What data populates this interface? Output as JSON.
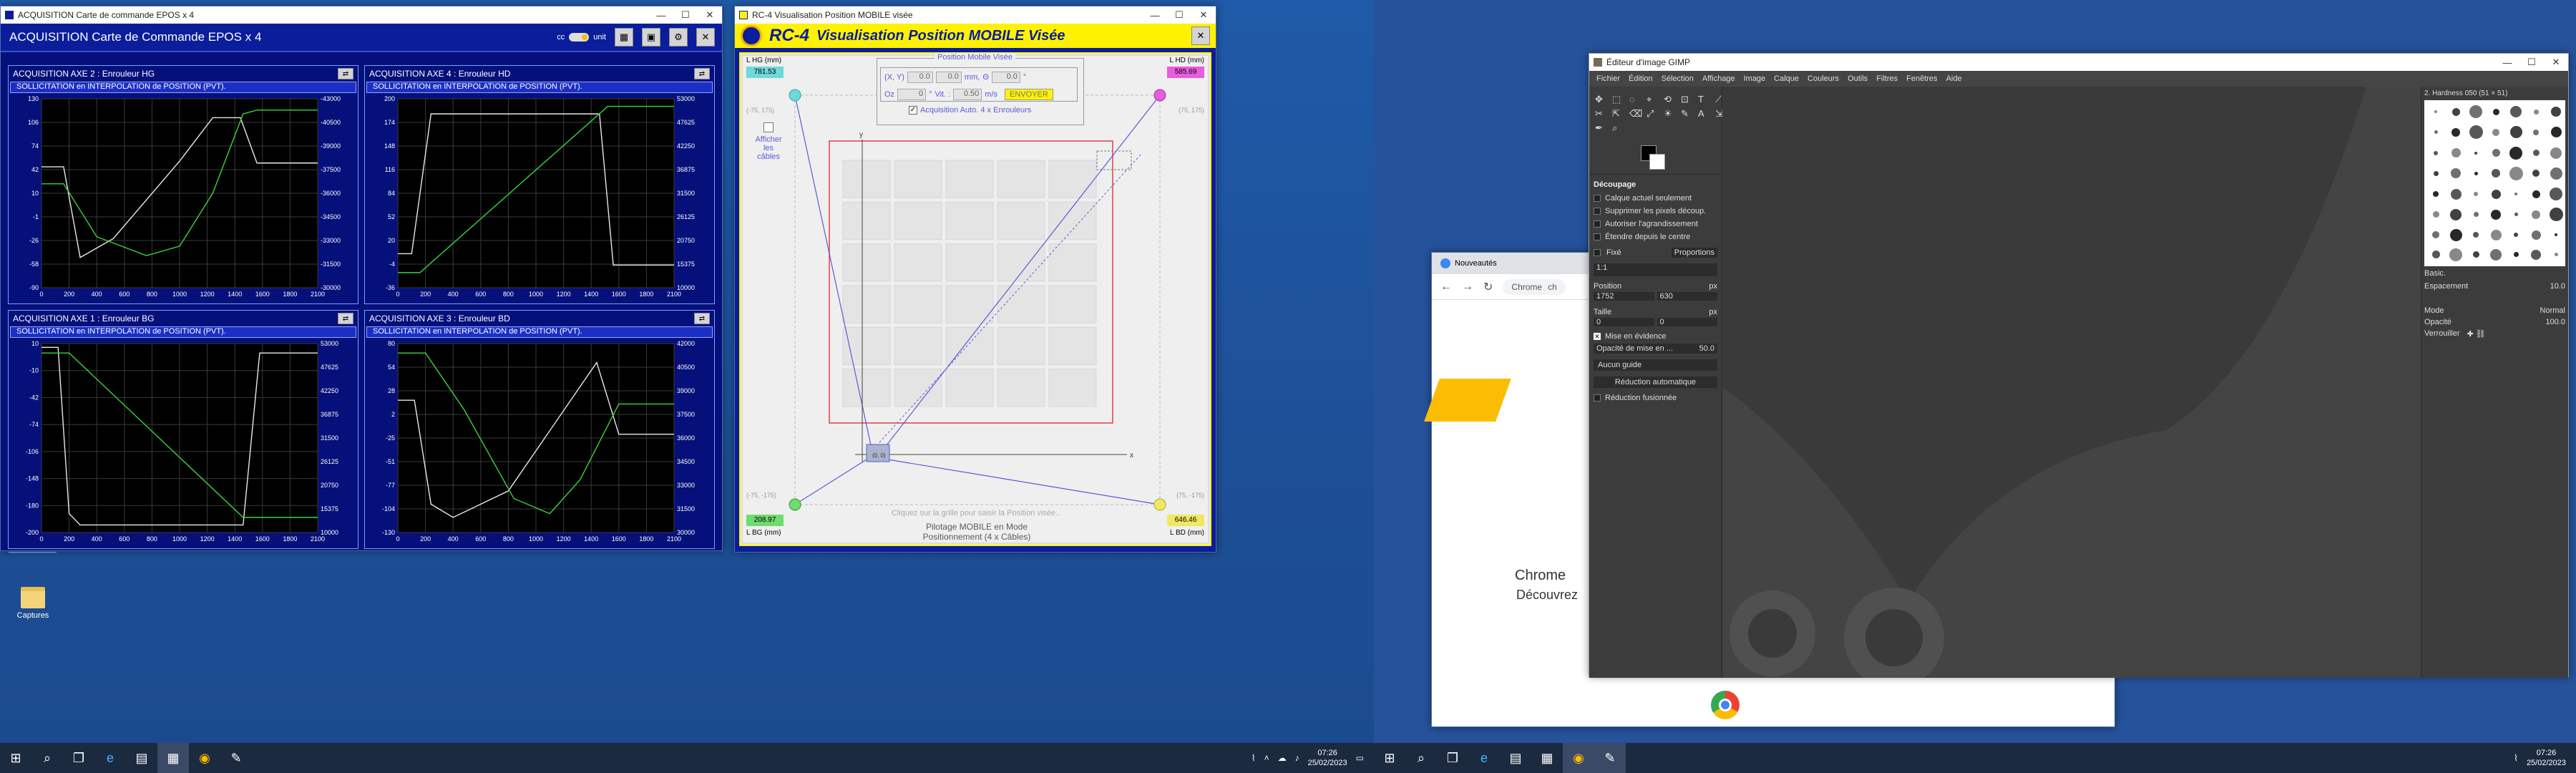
{
  "desktop": {
    "icon_label": "Captures",
    "icon_label_top": "____________"
  },
  "epos": {
    "window_title": "ACQUISITION Carte de commande EPOS x 4",
    "header": "ACQUISITION Carte de Commande EPOS x 4",
    "header_units": "unit",
    "header_pct": "cc",
    "panels": [
      {
        "title": "ACQUISITION AXE 2 : Enrouleur HG",
        "sub": "SOLLICITATION en INTERPOLATION de POSITION (PVT).",
        "left_ticks": [
          "130",
          "106",
          "74",
          "42",
          "10",
          "-1",
          "-26",
          "-58",
          "-90"
        ],
        "right_ticks": [
          "-43000",
          "-40500",
          "-39000",
          "-37500",
          "-36000",
          "-34500",
          "-33000",
          "-31500",
          "-30000"
        ],
        "x_ticks": [
          "0",
          "200",
          "400",
          "600",
          "800",
          "1000",
          "1200",
          "1400",
          "1600",
          "1800",
          "2100"
        ]
      },
      {
        "title": "ACQUISITION AXE 4 : Enrouleur HD",
        "sub": "SOLLICITATION en INTERPOLATION de POSITION (PVT).",
        "left_ticks": [
          "200",
          "174",
          "148",
          "116",
          "84",
          "52",
          "20",
          "-4",
          "-36"
        ],
        "right_ticks": [
          "53000",
          "47625",
          "42250",
          "36875",
          "31500",
          "26125",
          "20750",
          "15375",
          "10000"
        ],
        "x_ticks": [
          "0",
          "200",
          "400",
          "600",
          "800",
          "1000",
          "1200",
          "1400",
          "1600",
          "1800",
          "2100"
        ]
      },
      {
        "title": "ACQUISITION AXE 1 : Enrouleur BG",
        "sub": "SOLLICITATION en INTERPOLATION de POSITION (PVT).",
        "left_ticks": [
          "10",
          "-10",
          "-42",
          "-74",
          "-106",
          "-148",
          "-180",
          "-200"
        ],
        "right_ticks": [
          "53000",
          "47625",
          "42250",
          "36875",
          "31500",
          "26125",
          "20750",
          "15375",
          "10000"
        ],
        "x_ticks": [
          "0",
          "200",
          "400",
          "600",
          "800",
          "1000",
          "1200",
          "1400",
          "1600",
          "1800",
          "2100"
        ]
      },
      {
        "title": "ACQUISITION AXE 3 : Enrouleur BD",
        "sub": "SOLLICITATION en INTERPOLATION de POSITION (PVT).",
        "left_ticks": [
          "80",
          "54",
          "28",
          "2",
          "-25",
          "-51",
          "-77",
          "-104",
          "-130"
        ],
        "right_ticks": [
          "42000",
          "40500",
          "39000",
          "37500",
          "36000",
          "34500",
          "33000",
          "31500",
          "30000"
        ],
        "x_ticks": [
          "0",
          "200",
          "400",
          "600",
          "800",
          "1000",
          "1200",
          "1400",
          "1600",
          "1800",
          "2100"
        ]
      }
    ]
  },
  "rc4": {
    "window_title": "RC-4 Visualisation Position MOBILE visée",
    "logo": "RC-4",
    "title": "Visualisation Position MOBILE Visée",
    "lhg": "L HG (mm)",
    "lhd": "L HD (mm)",
    "lbg": "L BG (mm)",
    "lbd": "L BD (mm)",
    "val_hg": "781.53",
    "val_hd": "585.69",
    "val_bg": "208.97",
    "val_bd": "646.46",
    "coord_hg": "(-75, 175)",
    "coord_hd": "(75, 175)",
    "coord_bg": "(-75, -175)",
    "coord_bd": "(75, -175)",
    "afficher": "Afficher",
    "les": "les",
    "cables": "câbles",
    "group_title": "Position Mobile Visée",
    "xy_label": "(X, Y)",
    "x_val": "0.0",
    "y_val": "0.0",
    "mm": "mm,",
    "theta_label": "Θ",
    "theta_val": "0.0",
    "deg": "°",
    "oz_label": "Oz",
    "oz_val": "0",
    "vit_label": "Vit. :",
    "vit_val": "0.50",
    "ms": "m/s",
    "send": "ENVOYER",
    "auto": "Acquisition Auto. 4 x Enrouleurs",
    "hint": "Cliquez sur la grille pour saisir la Position visée...",
    "mode": "Pilotage MOBILE en Mode",
    "mode2": "Positionnement (4 x Câbles)",
    "axis_x": "x",
    "axis_y": "y",
    "pos_label": "(0, 0)"
  },
  "gimp": {
    "window_title": "Éditeur d'image GIMP",
    "menu": [
      "Fichier",
      "Édition",
      "Sélection",
      "Affichage",
      "Image",
      "Calque",
      "Couleurs",
      "Outils",
      "Filtres",
      "Fenêtres",
      "Aide"
    ],
    "crop_title": "Découpage",
    "opts": [
      "Calque actuel seulement",
      "Supprimer les pixels découp.",
      "Autoriser l'agrandissement",
      "Étendre depuis le centre"
    ],
    "fixe": "Fixé",
    "proportions": "Proportions",
    "ratio": "1:1",
    "position": "Position",
    "px": "px",
    "pos_x": "1752",
    "pos_y": "630",
    "taille": "Taille",
    "t_x": "0",
    "t_y": "0",
    "highlight": "Mise en évidence",
    "opacity": "Opacité de mise en ...",
    "opacity_val": "50.0",
    "guides": "Aucun guide",
    "auto_shrink": "Réduction automatique",
    "merged": "Réduction fusionnée",
    "brush": "2. Hardness 050 (51 × 51)",
    "basic": "Basic.",
    "espacement": "Espacement",
    "esp_val": "10.0",
    "mode": "Mode",
    "mode_val": "Normal",
    "opacite": "Opacité",
    "op_val": "100.0",
    "verrouiller": "Verrouiller"
  },
  "chrome": {
    "tab": "Nouveautés",
    "addr": "Chrome",
    "addr2": "ch",
    "heading": "Chrome",
    "sub": "Découvrez"
  },
  "taskbar_left": {
    "time": "07:26",
    "date": "25/02/2023"
  },
  "taskbar_right": {
    "time": "07:26",
    "date": "25/02/2023"
  }
}
